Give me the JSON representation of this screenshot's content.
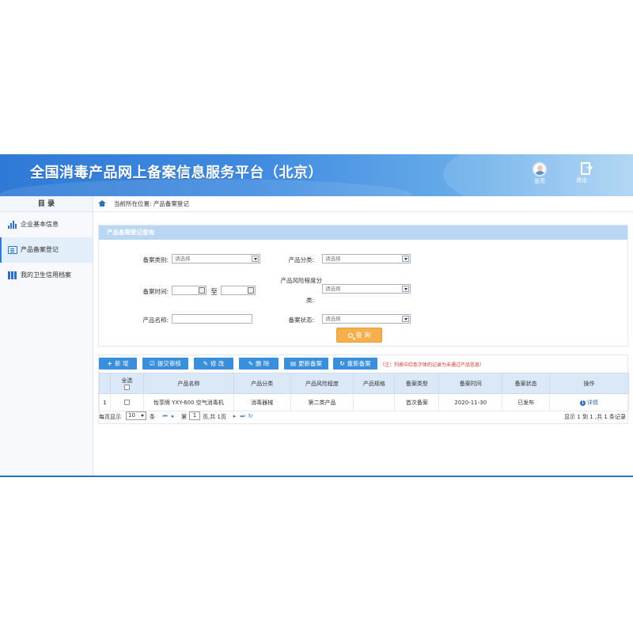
{
  "header": {
    "title": "全国消毒产品网上备案信息服务平台（北京）",
    "user_name": "张亮",
    "logout_label": "退出"
  },
  "sidebar": {
    "title": "目 录",
    "items": [
      {
        "label": "企业基本信息",
        "icon": "bar-chart-icon"
      },
      {
        "label": "产品备案登记",
        "icon": "document-icon"
      },
      {
        "label": "我的卫生信用档案",
        "icon": "books-icon"
      }
    ]
  },
  "breadcrumb": {
    "text": "当前所在位置:  产品备案登记"
  },
  "query": {
    "panel_title": "产品备案登记查询",
    "category_label": "备案类别:",
    "category_value": "请选择",
    "product_class_label": "产品分类:",
    "product_class_value": "请选择",
    "time_label": "备案时间:",
    "to_label": "至",
    "risk_label_line1": "产品风险程度分",
    "risk_label_line2": "类:",
    "risk_value": "请选择",
    "name_label": "产品名称:",
    "status_label": "备案状态:",
    "status_value": "请选择",
    "query_button": "查 询"
  },
  "toolbar": {
    "add": "新 增",
    "submit": "提交审核",
    "edit": "修 改",
    "delete": "删 除",
    "update": "更新备案",
    "refile": "重新备案",
    "note": "（注：列表中红色字体的记录为未通过产品信息）"
  },
  "table": {
    "headers": [
      "全选",
      "产品名称",
      "产品分类",
      "产品风险程度",
      "产品规格",
      "备案类型",
      "备案时间",
      "备案状态",
      "操作"
    ],
    "rows": [
      {
        "index": "1",
        "name": "怡享牌 YXY-600 空气消毒机",
        "class": "消毒器械",
        "risk": "第二类产品",
        "spec": "",
        "type": "首次备案",
        "time": "2020-11-30",
        "status": "已发布",
        "action": "详情"
      }
    ]
  },
  "pager": {
    "per_page_label": "每页显示",
    "per_page_value": "10",
    "unit": "条",
    "page_prefix": "第",
    "page_value": "1",
    "page_suffix": "页,共 1页",
    "summary": "显示 1 到 1 ,共 1 条记录"
  },
  "colors": {
    "header_blue": "#2f7ad6",
    "button_blue": "#3a8fdc",
    "query_orange": "#f5b04d",
    "note_red": "#d9342b"
  }
}
